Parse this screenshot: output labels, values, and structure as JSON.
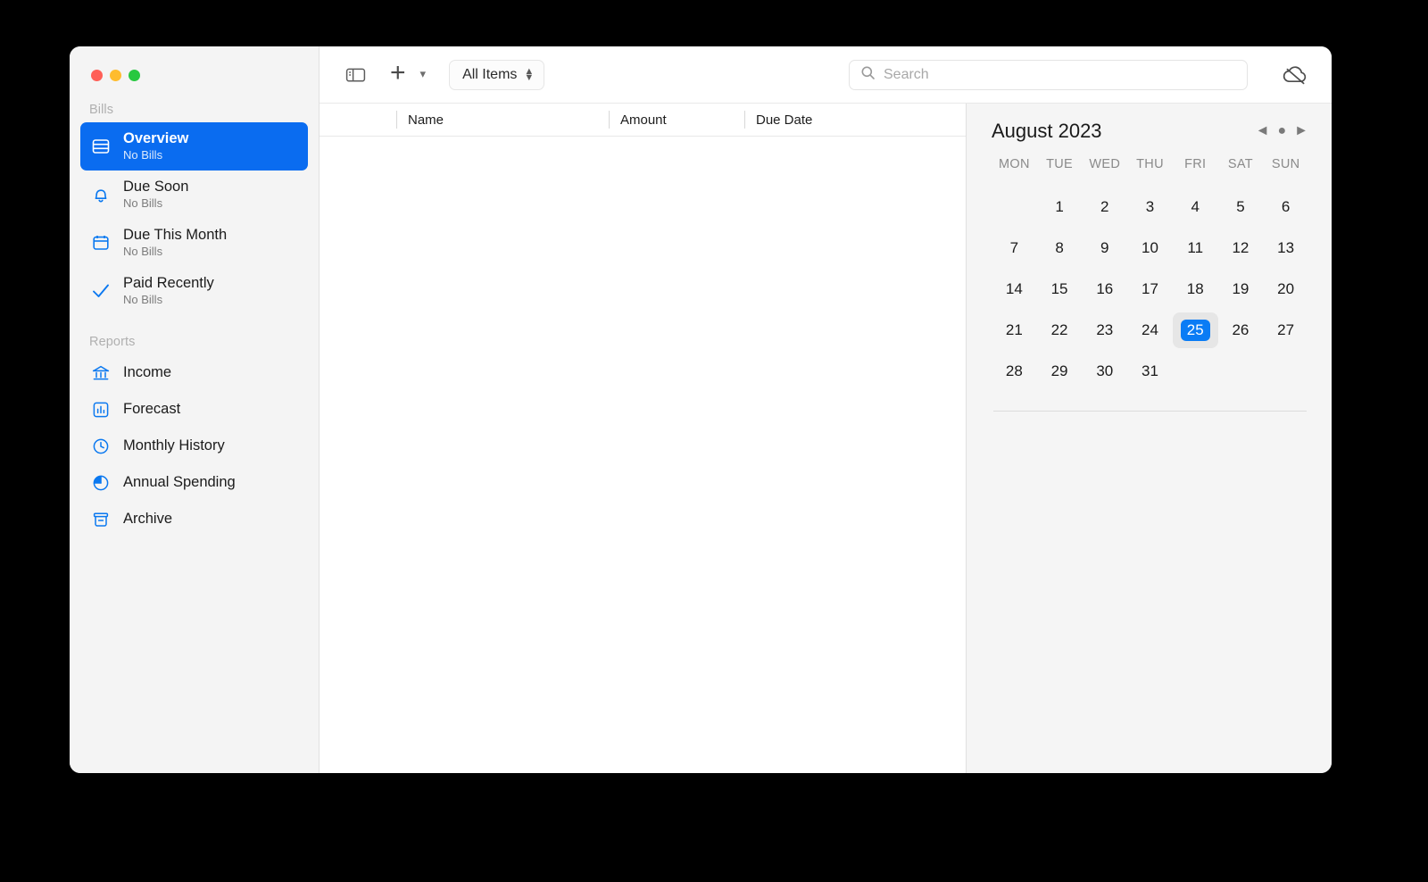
{
  "window": {
    "traffic_lights": [
      "close",
      "minimize",
      "maximize"
    ],
    "colors": {
      "close": "#ff5f57",
      "minimize": "#febc2e",
      "maximize": "#28c840",
      "accent": "#0a6cf0",
      "icon_blue": "#0a78f0",
      "today_badge": "#0a7cf5"
    }
  },
  "sidebar": {
    "sections": [
      {
        "header": "Bills",
        "items": [
          {
            "label": "Overview",
            "sublabel": "No Bills",
            "icon": "list-rows-icon",
            "selected": true
          },
          {
            "label": "Due Soon",
            "sublabel": "No Bills",
            "icon": "bell-icon",
            "selected": false
          },
          {
            "label": "Due This Month",
            "sublabel": "No Bills",
            "icon": "calendar-icon",
            "selected": false
          },
          {
            "label": "Paid Recently",
            "sublabel": "No Bills",
            "icon": "checkmark-icon",
            "selected": false
          }
        ]
      },
      {
        "header": "Reports",
        "items": [
          {
            "label": "Income",
            "icon": "bank-icon"
          },
          {
            "label": "Forecast",
            "icon": "bar-chart-icon"
          },
          {
            "label": "Monthly History",
            "icon": "clock-icon"
          },
          {
            "label": "Annual Spending",
            "icon": "pie-chart-icon"
          },
          {
            "label": "Archive",
            "icon": "archive-box-icon"
          }
        ]
      }
    ]
  },
  "toolbar": {
    "sidebar_toggle_icon": "sidebar-toggle-icon",
    "add_icon": "plus-icon",
    "add_menu_icon": "chevron-down-icon",
    "filter_label": "All Items",
    "filter_stepper_icon": "up-down-chevron-icon",
    "search": {
      "icon": "search-icon",
      "value": "",
      "placeholder": "Search"
    },
    "cloud_icon": "cloud-slash-icon"
  },
  "list": {
    "columns": [
      "Name",
      "Amount",
      "Due Date"
    ],
    "rows": []
  },
  "calendar": {
    "title": "August 2023",
    "nav": {
      "prev_icon": "triangle-left-icon",
      "today_icon": "circle-dot-icon",
      "next_icon": "triangle-right-icon"
    },
    "weekdays": [
      "MON",
      "TUE",
      "WED",
      "THU",
      "FRI",
      "SAT",
      "SUN"
    ],
    "leading_blanks": 1,
    "days": [
      1,
      2,
      3,
      4,
      5,
      6,
      7,
      8,
      9,
      10,
      11,
      12,
      13,
      14,
      15,
      16,
      17,
      18,
      19,
      20,
      21,
      22,
      23,
      24,
      25,
      26,
      27,
      28,
      29,
      30,
      31
    ],
    "selected_day": 25
  }
}
